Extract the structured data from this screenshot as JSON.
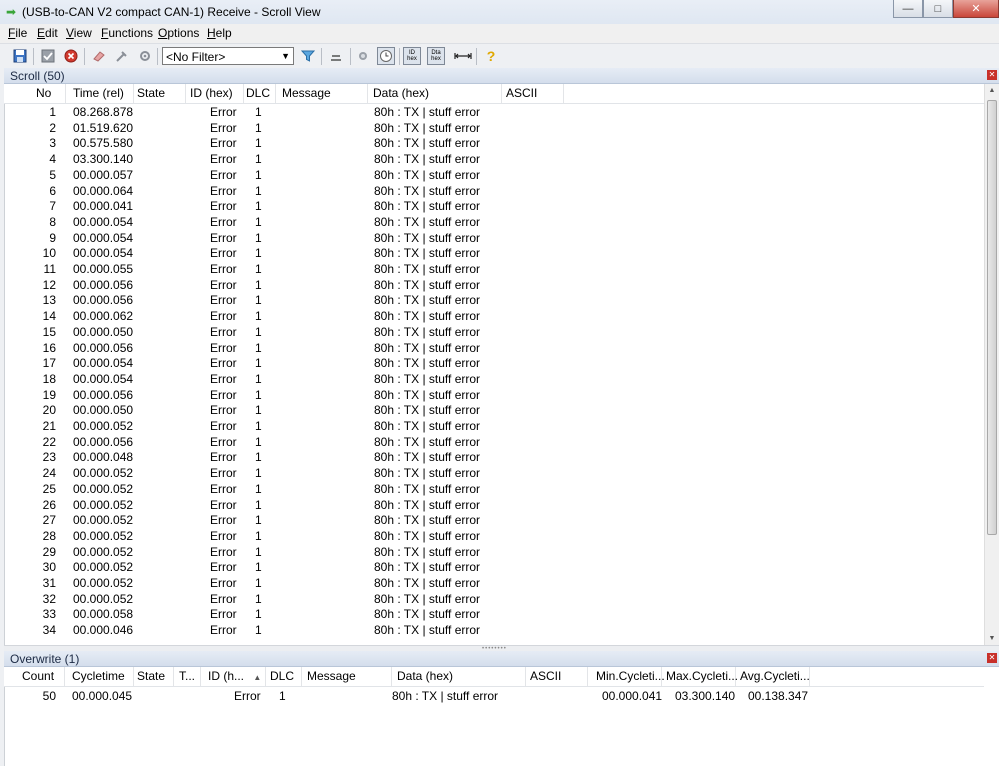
{
  "window": {
    "title": "(USB-to-CAN V2 compact  CAN-1) Receive - Scroll View",
    "controls": {
      "minimize": "—",
      "maximize": "□",
      "close": "✕"
    }
  },
  "menu": [
    "File",
    "Edit",
    "View",
    "Functions",
    "Options",
    "Help"
  ],
  "toolbar": {
    "filter_value": "<No Filter>",
    "id_hex_top": "ID",
    "id_hex_bottom": "hex",
    "data_hex_top": "Dta",
    "data_hex_bottom": "hex",
    "help_glyph": "?"
  },
  "scroll_panel": {
    "title": "Scroll (50)",
    "columns": [
      "No",
      "Time (rel)",
      "State",
      "ID (hex)",
      "DLC",
      "Message",
      "Data (hex)",
      "ASCII"
    ],
    "rows": [
      {
        "no": "1",
        "time": "08.268.878",
        "id": "Error",
        "dlc": "1",
        "data": "80h : TX | stuff error"
      },
      {
        "no": "2",
        "time": "01.519.620",
        "id": "Error",
        "dlc": "1",
        "data": "80h : TX | stuff error"
      },
      {
        "no": "3",
        "time": "00.575.580",
        "id": "Error",
        "dlc": "1",
        "data": "80h : TX | stuff error"
      },
      {
        "no": "4",
        "time": "03.300.140",
        "id": "Error",
        "dlc": "1",
        "data": "80h : TX | stuff error"
      },
      {
        "no": "5",
        "time": "00.000.057",
        "id": "Error",
        "dlc": "1",
        "data": "80h : TX | stuff error"
      },
      {
        "no": "6",
        "time": "00.000.064",
        "id": "Error",
        "dlc": "1",
        "data": "80h : TX | stuff error"
      },
      {
        "no": "7",
        "time": "00.000.041",
        "id": "Error",
        "dlc": "1",
        "data": "80h : TX | stuff error"
      },
      {
        "no": "8",
        "time": "00.000.054",
        "id": "Error",
        "dlc": "1",
        "data": "80h : TX | stuff error"
      },
      {
        "no": "9",
        "time": "00.000.054",
        "id": "Error",
        "dlc": "1",
        "data": "80h : TX | stuff error"
      },
      {
        "no": "10",
        "time": "00.000.054",
        "id": "Error",
        "dlc": "1",
        "data": "80h : TX | stuff error"
      },
      {
        "no": "11",
        "time": "00.000.055",
        "id": "Error",
        "dlc": "1",
        "data": "80h : TX | stuff error"
      },
      {
        "no": "12",
        "time": "00.000.056",
        "id": "Error",
        "dlc": "1",
        "data": "80h : TX | stuff error"
      },
      {
        "no": "13",
        "time": "00.000.056",
        "id": "Error",
        "dlc": "1",
        "data": "80h : TX | stuff error"
      },
      {
        "no": "14",
        "time": "00.000.062",
        "id": "Error",
        "dlc": "1",
        "data": "80h : TX | stuff error"
      },
      {
        "no": "15",
        "time": "00.000.050",
        "id": "Error",
        "dlc": "1",
        "data": "80h : TX | stuff error"
      },
      {
        "no": "16",
        "time": "00.000.056",
        "id": "Error",
        "dlc": "1",
        "data": "80h : TX | stuff error"
      },
      {
        "no": "17",
        "time": "00.000.054",
        "id": "Error",
        "dlc": "1",
        "data": "80h : TX | stuff error"
      },
      {
        "no": "18",
        "time": "00.000.054",
        "id": "Error",
        "dlc": "1",
        "data": "80h : TX | stuff error"
      },
      {
        "no": "19",
        "time": "00.000.056",
        "id": "Error",
        "dlc": "1",
        "data": "80h : TX | stuff error"
      },
      {
        "no": "20",
        "time": "00.000.050",
        "id": "Error",
        "dlc": "1",
        "data": "80h : TX | stuff error"
      },
      {
        "no": "21",
        "time": "00.000.052",
        "id": "Error",
        "dlc": "1",
        "data": "80h : TX | stuff error"
      },
      {
        "no": "22",
        "time": "00.000.056",
        "id": "Error",
        "dlc": "1",
        "data": "80h : TX | stuff error"
      },
      {
        "no": "23",
        "time": "00.000.048",
        "id": "Error",
        "dlc": "1",
        "data": "80h : TX | stuff error"
      },
      {
        "no": "24",
        "time": "00.000.052",
        "id": "Error",
        "dlc": "1",
        "data": "80h : TX | stuff error"
      },
      {
        "no": "25",
        "time": "00.000.052",
        "id": "Error",
        "dlc": "1",
        "data": "80h : TX | stuff error"
      },
      {
        "no": "26",
        "time": "00.000.052",
        "id": "Error",
        "dlc": "1",
        "data": "80h : TX | stuff error"
      },
      {
        "no": "27",
        "time": "00.000.052",
        "id": "Error",
        "dlc": "1",
        "data": "80h : TX | stuff error"
      },
      {
        "no": "28",
        "time": "00.000.052",
        "id": "Error",
        "dlc": "1",
        "data": "80h : TX | stuff error"
      },
      {
        "no": "29",
        "time": "00.000.052",
        "id": "Error",
        "dlc": "1",
        "data": "80h : TX | stuff error"
      },
      {
        "no": "30",
        "time": "00.000.052",
        "id": "Error",
        "dlc": "1",
        "data": "80h : TX | stuff error"
      },
      {
        "no": "31",
        "time": "00.000.052",
        "id": "Error",
        "dlc": "1",
        "data": "80h : TX | stuff error"
      },
      {
        "no": "32",
        "time": "00.000.052",
        "id": "Error",
        "dlc": "1",
        "data": "80h : TX | stuff error"
      },
      {
        "no": "33",
        "time": "00.000.058",
        "id": "Error",
        "dlc": "1",
        "data": "80h : TX | stuff error"
      },
      {
        "no": "34",
        "time": "00.000.046",
        "id": "Error",
        "dlc": "1",
        "data": "80h : TX | stuff error"
      }
    ]
  },
  "overwrite_panel": {
    "title": "Overwrite (1)",
    "columns": [
      "Count",
      "Cycletime",
      "State",
      "T...",
      "ID (h...",
      "DLC",
      "Message",
      "Data (hex)",
      "ASCII",
      "Min.Cycleti...",
      "Max.Cycleti...",
      "Avg.Cycleti..."
    ],
    "sort_glyph": "▲",
    "row": {
      "count": "50",
      "cycletime": "00.000.045",
      "id": "Error",
      "dlc": "1",
      "data": "80h : TX | stuff error",
      "min": "00.000.041",
      "max": "03.300.140",
      "avg": "00.138.347"
    }
  }
}
